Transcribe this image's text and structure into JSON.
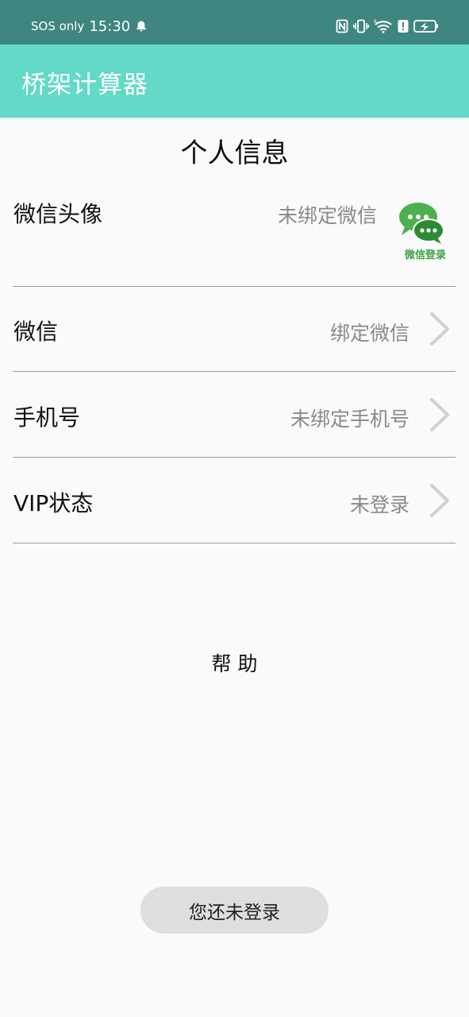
{
  "status_bar": {
    "carrier": "SOS only",
    "time": "15:30",
    "icons": [
      "bell-icon",
      "nfc-icon",
      "vibrate-icon",
      "wifi-icon",
      "alert-icon",
      "battery-charging-icon"
    ]
  },
  "app_bar": {
    "title": "桥架计算器",
    "color": "#63d9c7"
  },
  "page": {
    "title": "个人信息",
    "rows": [
      {
        "label": "微信头像",
        "value": "未绑定微信"
      },
      {
        "label": "微信",
        "value": "绑定微信"
      },
      {
        "label": "手机号",
        "value": "未绑定手机号"
      },
      {
        "label": "VIP状态",
        "value": "未登录"
      }
    ],
    "wechat_login_caption": "微信登录",
    "help": "帮助",
    "login_status": "您还未登录"
  }
}
